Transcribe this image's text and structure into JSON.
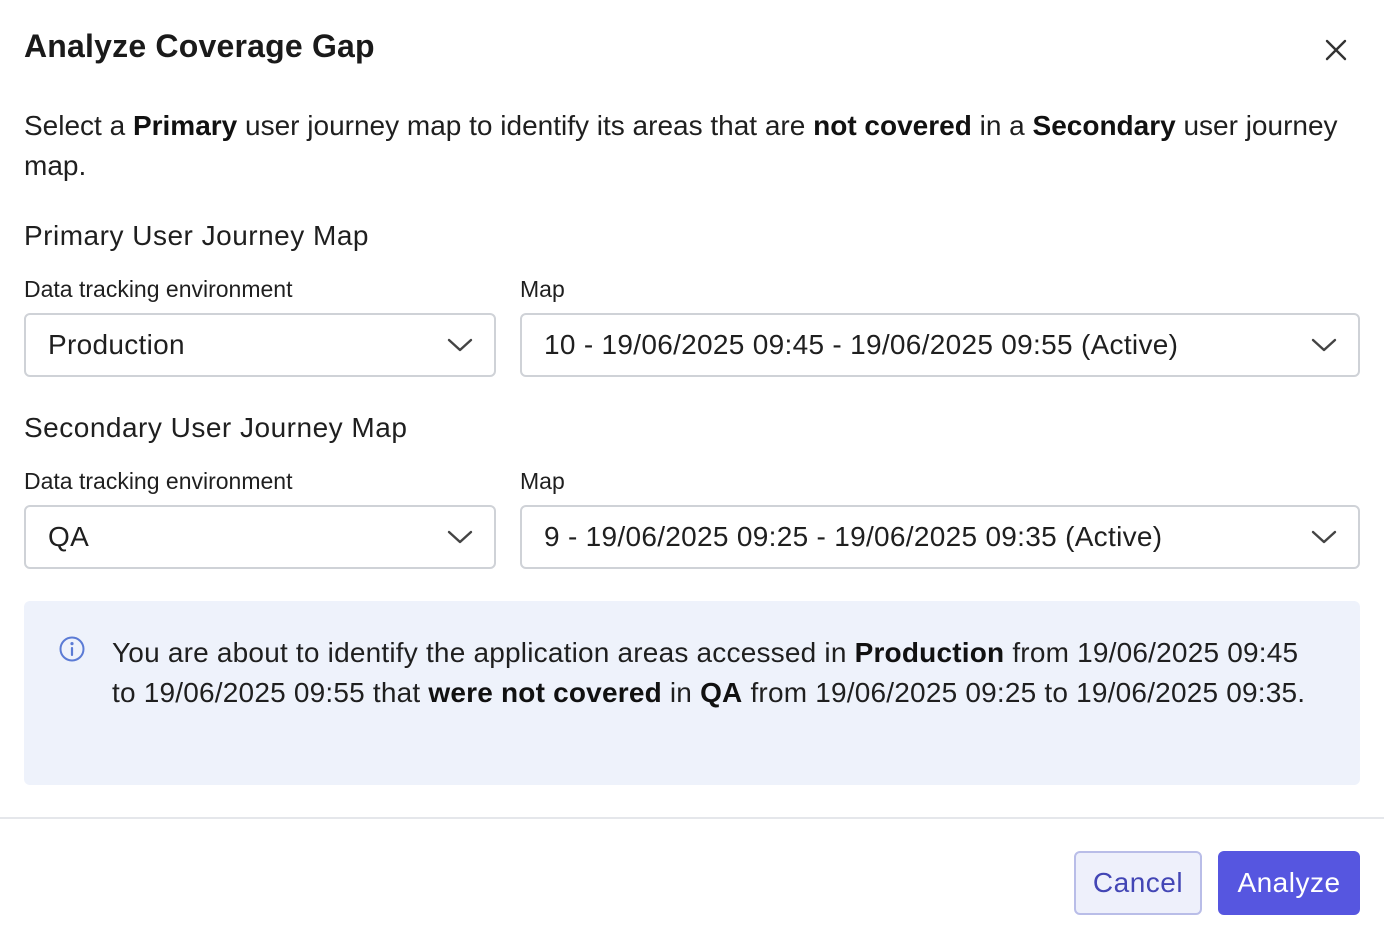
{
  "dialog": {
    "title": "Analyze Coverage Gap",
    "close_icon": "close-icon"
  },
  "intro": {
    "t1": "Select a ",
    "b1": "Primary",
    "t2": " user journey map to identify its areas that are ",
    "b2": "not covered",
    "t3": " in a ",
    "b3": "Secondary",
    "t4": " user journey map."
  },
  "primary": {
    "section_title": "Primary User Journey Map",
    "env_label": "Data tracking environment",
    "env_value": "Production",
    "map_label": "Map",
    "map_value": "10 - 19/06/2025 09:45 - 19/06/2025 09:55 (Active)"
  },
  "secondary": {
    "section_title": "Secondary User Journey Map",
    "env_label": "Data tracking environment",
    "env_value": "QA",
    "map_label": "Map",
    "map_value": "9 - 19/06/2025 09:25 - 19/06/2025 09:35 (Active)"
  },
  "info": {
    "icon": "info-icon",
    "t1": "You are about to identify the application areas accessed in ",
    "b1": "Production",
    "t2": " from 19/06/2025 09:45 to 19/06/2025 09:55 that ",
    "b2": "were not covered",
    "t3": " in ",
    "b3": "QA",
    "t4": " from 19/06/2025 09:25 to 19/06/2025 09:35."
  },
  "footer": {
    "cancel_label": "Cancel",
    "analyze_label": "Analyze"
  },
  "colors": {
    "accent": "#5656e0",
    "info_bg": "#eef2fb",
    "info_icon": "#5b7bd5"
  }
}
